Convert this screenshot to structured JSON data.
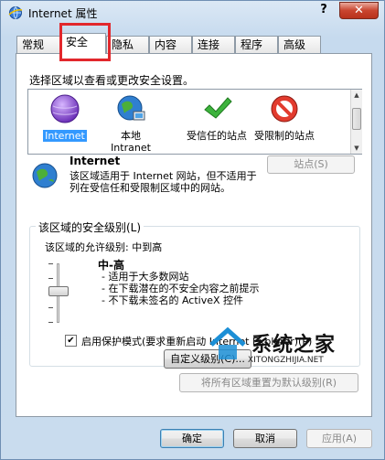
{
  "window": {
    "title": "Internet 属性",
    "help": "?",
    "close": "✕"
  },
  "tabs": [
    {
      "label": "常规"
    },
    {
      "label": "安全"
    },
    {
      "label": "隐私"
    },
    {
      "label": "内容"
    },
    {
      "label": "连接"
    },
    {
      "label": "程序"
    },
    {
      "label": "高级"
    }
  ],
  "active_tab": "安全",
  "zone_prompt": "选择区域以查看或更改安全设置。",
  "zones": [
    {
      "label": "Internet",
      "selected": true
    },
    {
      "label": "本地\nIntranet"
    },
    {
      "label": "受信任的站点"
    },
    {
      "label": "受限制的站点"
    }
  ],
  "zone_info": {
    "title": "Internet",
    "description": "该区域适用于 Internet 网站，但不适用于列在受信任和受限制区域中的网站。"
  },
  "sites_button": "站点(S)",
  "security_level": {
    "legend": "该区域的安全级别(L)",
    "allowed_label": "该区域的允许级别: 中到高",
    "level_name": "中-高",
    "level_value": "中-高",
    "bullets": [
      "- 适用于大多数网站",
      "- 在下载潜在的不安全内容之前提示",
      "- 不下载未签名的 ActiveX 控件"
    ]
  },
  "protected_mode": {
    "checked": true,
    "label": "启用保护模式(要求重新启动 Internet Explorer)(P)"
  },
  "custom_level_button": "自定义级别(C)...",
  "reset_all_button": "将所有区域重置为默认级别(R)",
  "footer": {
    "ok": "确定",
    "cancel": "取消",
    "apply": "应用(A)"
  },
  "watermark": {
    "brand": "系统之家",
    "url": "XITONGZHIJIA.NET"
  },
  "colors": {
    "highlight": "#3399ff",
    "callout": "#e2272c"
  }
}
